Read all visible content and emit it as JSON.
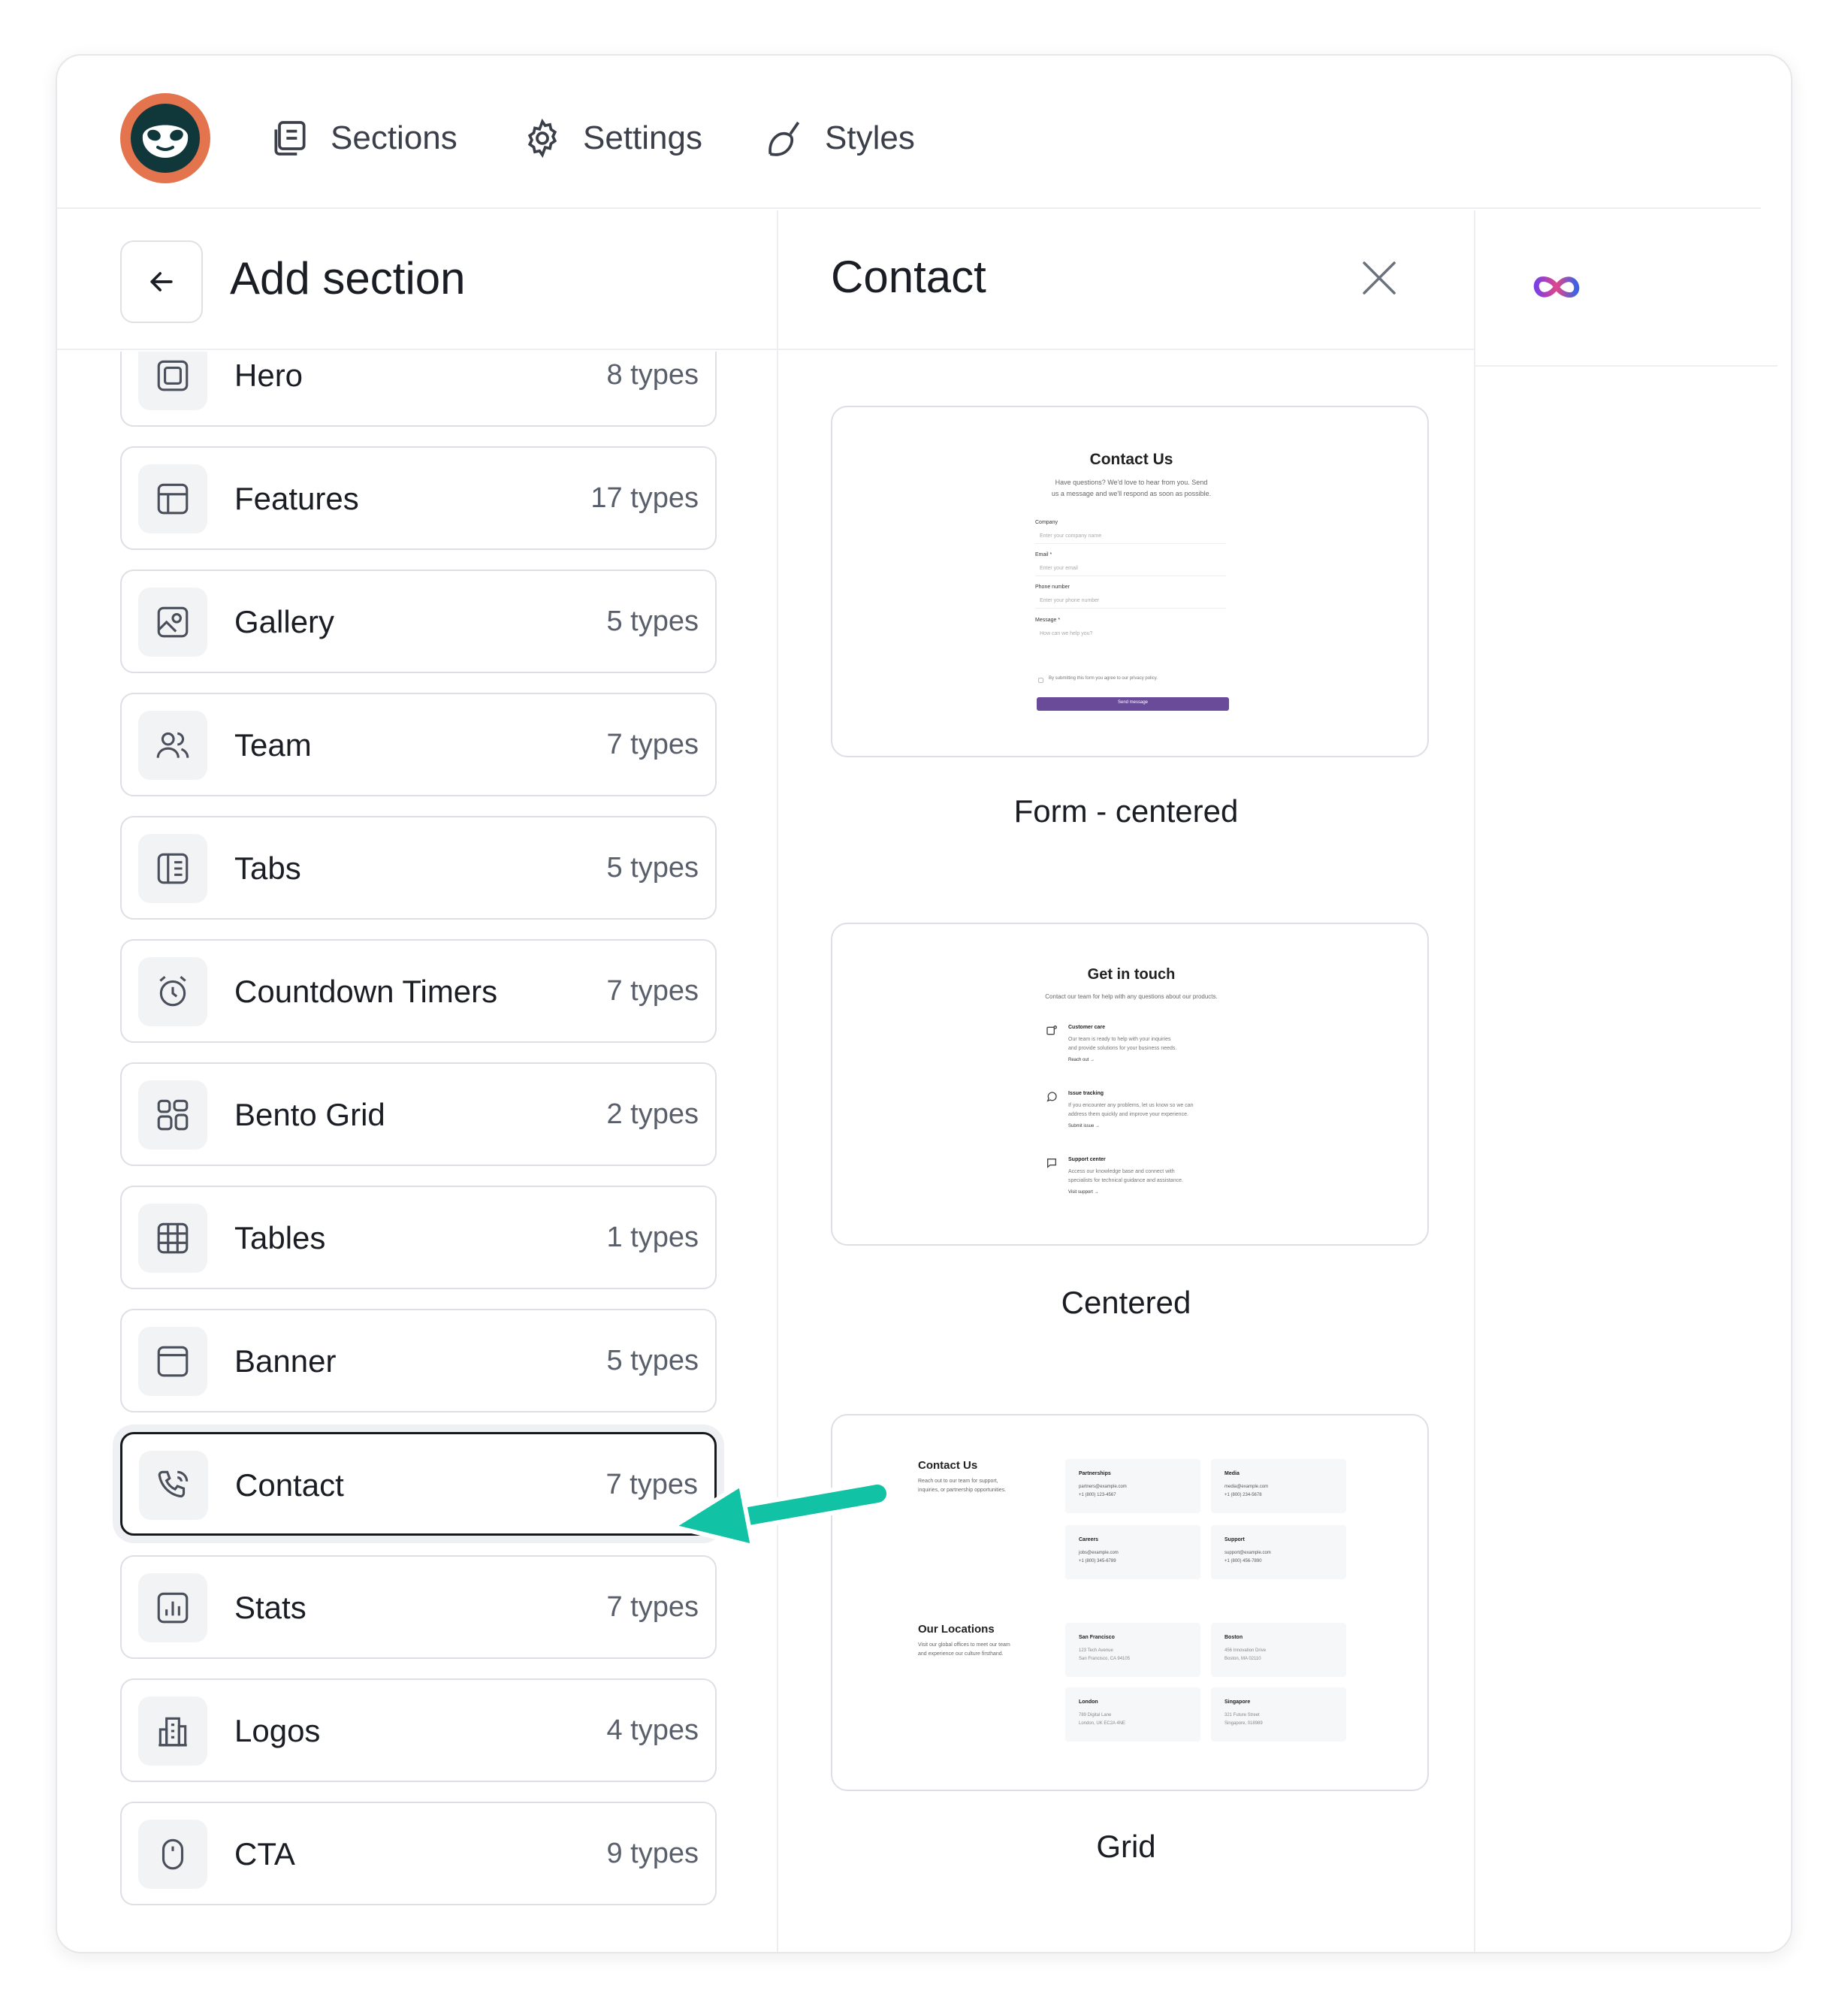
{
  "nav": {
    "sections_label": "Sections",
    "settings_label": "Settings",
    "styles_label": "Styles"
  },
  "left_panel": {
    "title": "Add section",
    "items": [
      {
        "label": "Hero",
        "count": "8 types",
        "icon": "hero-icon"
      },
      {
        "label": "Features",
        "count": "17 types",
        "icon": "layout-icon"
      },
      {
        "label": "Gallery",
        "count": "5 types",
        "icon": "image-icon"
      },
      {
        "label": "Team",
        "count": "7 types",
        "icon": "users-icon"
      },
      {
        "label": "Tabs",
        "count": "5 types",
        "icon": "tabs-icon"
      },
      {
        "label": "Countdown Timers",
        "count": "7 types",
        "icon": "alarm-clock-icon"
      },
      {
        "label": "Bento Grid",
        "count": "2 types",
        "icon": "grid-icon"
      },
      {
        "label": "Tables",
        "count": "1 types",
        "icon": "table-icon"
      },
      {
        "label": "Banner",
        "count": "5 types",
        "icon": "banner-icon"
      },
      {
        "label": "Contact",
        "count": "7 types",
        "icon": "phone-icon"
      },
      {
        "label": "Stats",
        "count": "7 types",
        "icon": "bar-chart-icon"
      },
      {
        "label": "Logos",
        "count": "4 types",
        "icon": "building-icon"
      },
      {
        "label": "CTA",
        "count": "9 types",
        "icon": "mouse-icon"
      }
    ],
    "active_item": "Contact"
  },
  "middle_panel": {
    "title": "Contact",
    "previews": [
      {
        "caption": "Form - centered",
        "heading": "Contact Us",
        "subtitle_1": "Have questions? We'd love to hear from you. Send",
        "subtitle_2": "us a message and we'll respond as soon as possible.",
        "fields": [
          {
            "label": "Company",
            "placeholder": "Enter your company name"
          },
          {
            "label": "Email *",
            "placeholder": "Enter your email"
          },
          {
            "label": "Phone number",
            "placeholder": "Enter your phone number"
          },
          {
            "label": "Message *",
            "placeholder": "How can we help you?"
          }
        ],
        "consent": "By submitting this form you agree to our privacy policy.",
        "button": "Send message"
      },
      {
        "caption": "Centered",
        "heading": "Get in touch",
        "subtitle": "Contact our team for help with any questions about our products.",
        "items": [
          {
            "title": "Customer care",
            "line1": "Our team is ready to help with your inquiries",
            "line2": "and provide solutions for your business needs.",
            "link": "Reach out →"
          },
          {
            "title": "Issue tracking",
            "line1": "If you encounter any problems, let us know so we can",
            "line2": "address them quickly and improve your experience.",
            "link": "Submit issue →"
          },
          {
            "title": "Support center",
            "line1": "Access our knowledge base and connect with",
            "line2": "specialists for technical guidance and assistance.",
            "link": "Visit support →"
          }
        ]
      },
      {
        "caption": "Grid",
        "heading_1": "Contact Us",
        "desc_1a": "Reach out to our team for support,",
        "desc_1b": "inquiries, or partnership opportunities.",
        "heading_2": "Our Locations",
        "desc_2a": "Visit our global offices to meet our team",
        "desc_2b": "and experience our culture firsthand.",
        "contacts": [
          {
            "title": "Partnerships",
            "line1": "partners@example.com",
            "line2": "+1 (800) 123-4567"
          },
          {
            "title": "Media",
            "line1": "media@example.com",
            "line2": "+1 (800) 234-5678"
          },
          {
            "title": "Careers",
            "line1": "jobs@example.com",
            "line2": "+1 (800) 345-6789"
          },
          {
            "title": "Support",
            "line1": "support@example.com",
            "line2": "+1 (800) 456-7890"
          }
        ],
        "locations": [
          {
            "title": "San Francisco",
            "line1": "123 Tech Avenue",
            "line2": "San Francisco, CA 94105"
          },
          {
            "title": "Boston",
            "line1": "456 Innovation Drive",
            "line2": "Boston, MA 02110"
          },
          {
            "title": "London",
            "line1": "789 Digital Lane",
            "line2": "London, UK EC2A 4NE"
          },
          {
            "title": "Singapore",
            "line1": "321 Future Street",
            "line2": "Singapore, 018989"
          }
        ]
      }
    ]
  },
  "colors": {
    "logo_ring": "#e4744d",
    "logo_face": "#10373a",
    "send_button": "#6a4b9a",
    "arrow": "#12c2a4",
    "active_border": "#15181d"
  }
}
